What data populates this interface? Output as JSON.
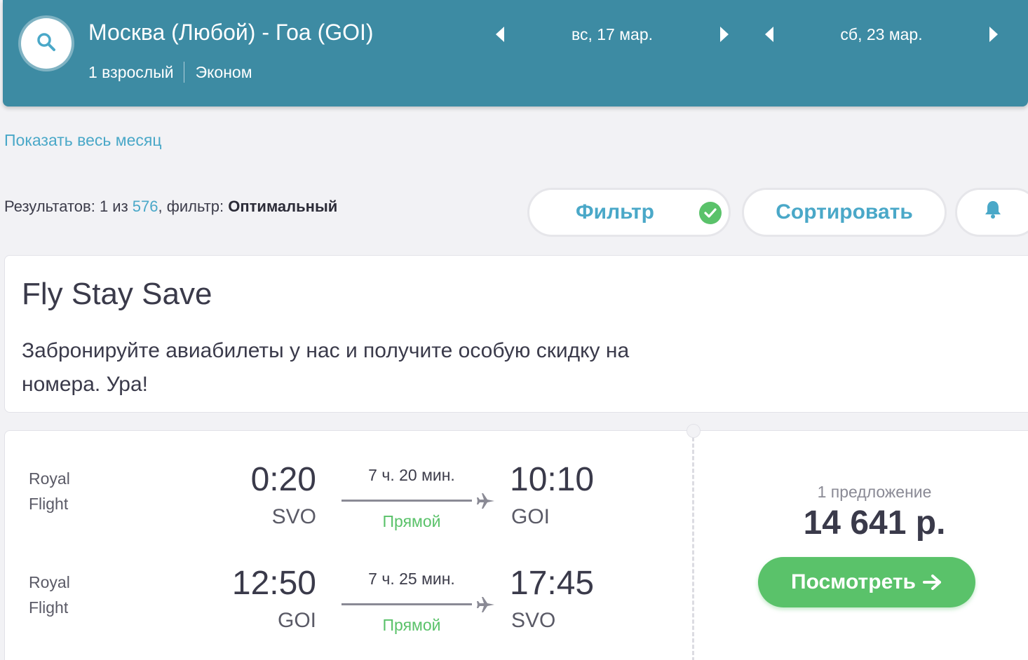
{
  "header": {
    "route": "Москва (Любой) - Гоа (GOI)",
    "passengers": "1 взрослый",
    "cabin": "Эконом",
    "depart_date": "вс, 17 мар.",
    "return_date": "сб, 23 мар."
  },
  "show_month_link": "Показать весь месяц",
  "results": {
    "prefix": "Результатов: 1 из ",
    "total": "576",
    "filter_prefix": ", фильтр: ",
    "filter_value": "Оптимальный"
  },
  "buttons": {
    "filter": "Фильтр",
    "sort": "Сортировать"
  },
  "icons": {
    "search": "search-icon",
    "filter_check": "check-circle-icon",
    "bell": "bell-icon",
    "plane": "plane-icon",
    "arrow": "arrow-right-icon"
  },
  "promo": {
    "title": "Fly Stay Save",
    "text": "Забронируйте авиабилеты у нас и получите особую скидку на номера. Ура!"
  },
  "ticket": {
    "segments": [
      {
        "airline": "Royal Flight",
        "dep_time": "0:20",
        "dep_code": "SVO",
        "duration": "7 ч. 20 мин.",
        "stops": "Прямой",
        "arr_time": "10:10",
        "arr_code": "GOI"
      },
      {
        "airline": "Royal Flight",
        "dep_time": "12:50",
        "dep_code": "GOI",
        "duration": "7 ч. 25 мин.",
        "stops": "Прямой",
        "arr_time": "17:45",
        "arr_code": "SVO"
      }
    ],
    "offers": "1 предложение",
    "price": "14 641 р.",
    "view_button": "Посмотреть"
  },
  "colors": {
    "header_bg": "#3d8ba3",
    "accent": "#4aa8c8",
    "green": "#5ac26a"
  }
}
